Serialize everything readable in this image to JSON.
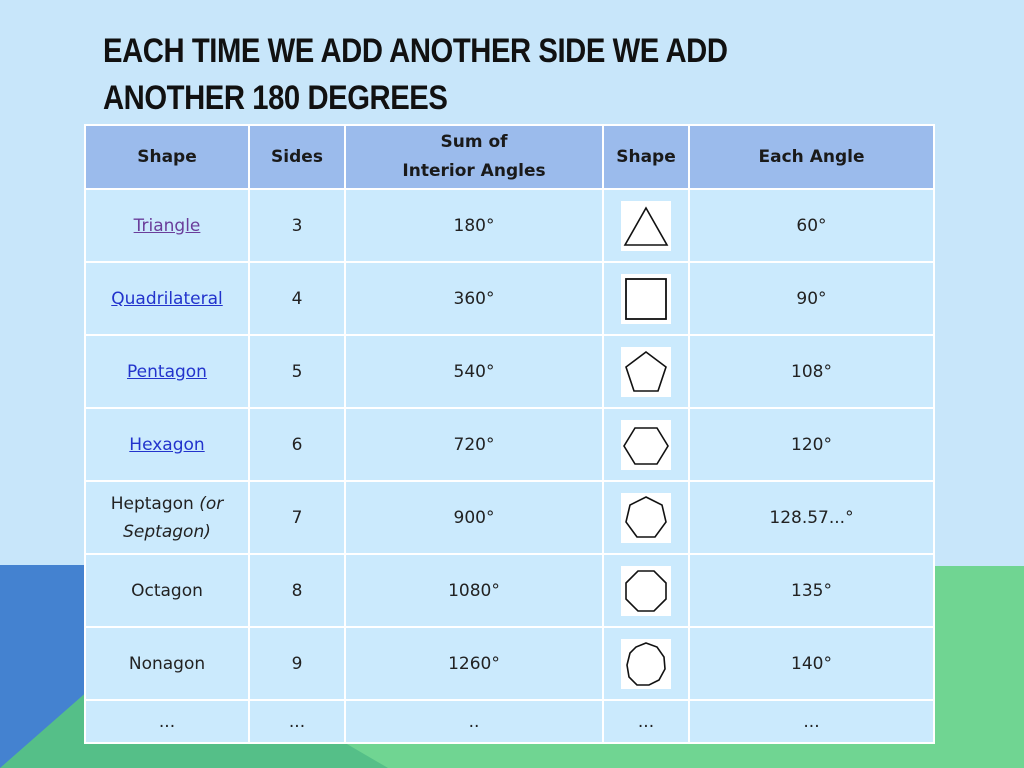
{
  "title": {
    "line1": "EACH TIME WE ADD ANOTHER SIDE WE ADD",
    "line2": "ANOTHER 180 DEGREES"
  },
  "table": {
    "headers": {
      "shape": "Shape",
      "sides": "Sides",
      "sum_line1": "Sum of",
      "sum_line2": "Interior Angles",
      "shape_img": "Shape",
      "each_angle": "Each Angle"
    },
    "rows": [
      {
        "name": "Triangle",
        "is_link": true,
        "visited": true,
        "sides": "3",
        "sum": "180°",
        "shape_icon": "triangle-icon",
        "each": "60°"
      },
      {
        "name": "Quadrilateral",
        "is_link": true,
        "visited": false,
        "sides": "4",
        "sum": "360°",
        "shape_icon": "square-icon",
        "each": "90°"
      },
      {
        "name": "Pentagon",
        "is_link": true,
        "visited": false,
        "sides": "5",
        "sum": "540°",
        "shape_icon": "pentagon-icon",
        "each": "108°"
      },
      {
        "name": "Hexagon",
        "is_link": true,
        "visited": false,
        "sides": "6",
        "sum": "720°",
        "shape_icon": "hexagon-icon",
        "each": "120°"
      },
      {
        "name": "Heptagon",
        "name_suffix": "(or",
        "name_line2": "Septagon)",
        "is_link": false,
        "sides": "7",
        "sum": "900°",
        "shape_icon": "heptagon-icon",
        "each": "128.57...°"
      },
      {
        "name": "Octagon",
        "is_link": false,
        "sides": "8",
        "sum": "1080°",
        "shape_icon": "octagon-icon",
        "each": "135°"
      },
      {
        "name": "Nonagon",
        "is_link": false,
        "sides": "9",
        "sum": "1260°",
        "shape_icon": "nonagon-icon",
        "each": "140°"
      },
      {
        "name": "...",
        "is_link": false,
        "sides": "...",
        "sum": "..",
        "shape_text": "...",
        "each": "..."
      }
    ]
  },
  "colors": {
    "background": "#c8e6fa",
    "header_cell": "#9bbbec",
    "body_cell": "#cbeafd",
    "link": "#2233cc",
    "visited_link": "#6a3d9a",
    "accent_blue": "#4482d0",
    "accent_green": "#70d592"
  }
}
